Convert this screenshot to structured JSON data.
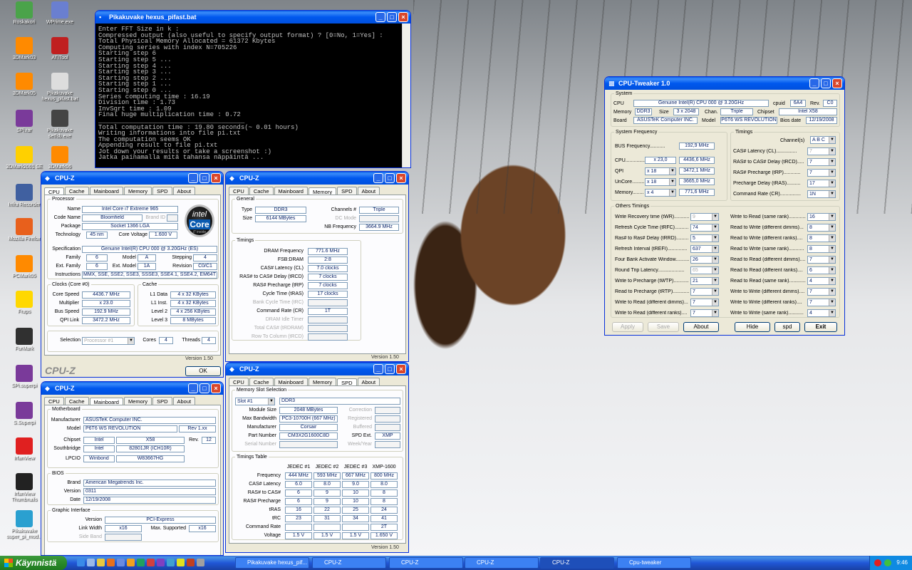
{
  "desktop_icons": [
    {
      "label": "Roskakori",
      "color": "#4aa34a"
    },
    {
      "label": "WPrime.exe",
      "color": "#6a7fd0"
    },
    {
      "label": "3DMark03",
      "color": "#ff8a00"
    },
    {
      "label": "ATITool",
      "color": "#c02020"
    },
    {
      "label": "3DMark05",
      "color": "#ff8a00"
    },
    {
      "label": "Pikakuvake hexus_pifast.bat",
      "color": "#dddddd"
    },
    {
      "label": "SPi.rar",
      "color": "#7a3a9a"
    },
    {
      "label": "Pikakuvake setfsb.exe",
      "color": "#444444"
    },
    {
      "label": "3DMark2001 SE",
      "color": "#ffd000"
    },
    {
      "label": "3DMark06",
      "color": "#ff8a00"
    },
    {
      "label": "Infra Recorder",
      "color": "#4060a0"
    },
    {
      "label": "Mozilla Firefox",
      "color": "#e8601c"
    },
    {
      "label": "PCMark05",
      "color": "#ff8a00"
    },
    {
      "label": "Fraps",
      "color": "#ffd800"
    },
    {
      "label": "FurMark",
      "color": "#303030"
    },
    {
      "label": "SPi.superpi",
      "color": "#7a3a9a"
    },
    {
      "label": "S.Superpi",
      "color": "#7a3a9a"
    },
    {
      "label": "IrfanView",
      "color": "#e02020"
    },
    {
      "label": "IrfanView Thumbnails",
      "color": "#222222"
    },
    {
      "label": "Pikakuvake super_pi_mod...",
      "color": "#2aa0d0"
    }
  ],
  "console": {
    "title": "Pikakuvake hexus_pifast.bat",
    "lines": [
      "",
      "Enter FFT Size in k :",
      "Compressed output (also useful to specify output format) ? [0=No, 1=Yes] :",
      "Total Physical Memory Allocated = 61372 Kbytes",
      "Computing series with index N=705226",
      "Starting step 6",
      "Starting step 5 ...",
      "Starting step 4 ...",
      "Starting step 3 ...",
      "Starting step 2 ...",
      "Starting step 1 ...",
      "Starting step 0 ...",
      "Series computing time : 16.19",
      "Division time : 1.73",
      "InvSqrt time : 1.09",
      "Final huge multiplication time : 0.72",
      "______________________________________",
      "Total computation time : 19.80 seconds(~ 0.01 hours)",
      "Writing informations into file pi.txt",
      "",
      "The computation seems OK",
      "Appending result to file pi.txt",
      "",
      "Jot down your results or take a screenshot :)",
      "Jatka painamalla mitä tahansa näppäintä ..."
    ]
  },
  "tabs": [
    "CPU",
    "Cache",
    "Mainboard",
    "Memory",
    "SPD",
    "About"
  ],
  "cpuz_title": "CPU-Z",
  "cpu": {
    "legend": "Processor",
    "name_l": "Name",
    "name": "Intel Core i7 Extreme 965",
    "code_l": "Code Name",
    "code": "Bloomfield",
    "brand_l": "Brand ID",
    "pkg_l": "Package",
    "pkg": "Socket 1366 LGA",
    "tech_l": "Technology",
    "tech": "45 nm",
    "cv_l": "Core Voltage",
    "cv": "1.600 V",
    "spec_l": "Specification",
    "spec": "Genuine Intel(R) CPU          000  @ 3.20GHz (ES)",
    "fam_l": "Family",
    "fam": "6",
    "model_l": "Model",
    "model": "A",
    "step_l": "Stepping",
    "step": "4",
    "efam_l": "Ext. Family",
    "efam": "6",
    "emod_l": "Ext. Model",
    "emod": "1A",
    "rev_l": "Revision",
    "rev": "C0/C1",
    "ins_l": "Instructions",
    "ins": "MMX, SSE, SSE2, SSE3, SSSE3, SSE4.1, SSE4.2, EM64T",
    "clk_legend": "Clocks (Core #0)",
    "cs_l": "Core Speed",
    "cs": "4436.7 MHz",
    "mul_l": "Multiplier",
    "mul": "x 23.0",
    "bs_l": "Bus Speed",
    "bs": "192.9 MHz",
    "qpi_l": "QPI Link",
    "qpi": "3472.2 MHz",
    "cache_legend": "Cache",
    "l1d_l": "L1 Data",
    "l1d": "4 x 32 KBytes",
    "l1i_l": "L1 Inst.",
    "l1i": "4 x 32 KBytes",
    "l2_l": "Level 2",
    "l2": "4 x 256 KBytes",
    "l3_l": "Level 3",
    "l3": "8 MBytes",
    "sel_l": "Selection",
    "sel": "Processor #1",
    "cores_l": "Cores",
    "cores": "4",
    "thr_l": "Threads",
    "thr": "4",
    "version": "Version 1.50",
    "brand": "CPU-Z",
    "ok": "OK",
    "logo1": "intel",
    "logo2": "Core",
    "logo3": "i7",
    "logo4": "inside"
  },
  "mem": {
    "gen_legend": "General",
    "type_l": "Type",
    "type": "DDR3",
    "ch_l": "Channels #",
    "ch": "Triple",
    "size_l": "Size",
    "size": "6144 MBytes",
    "dc_l": "DC Mode",
    "nb_l": "NB Frequency",
    "nb": "3664.9 MHz",
    "tim_legend": "Timings",
    "rows": [
      {
        "l": "DRAM Frequency",
        "v": "771.6 MHz",
        "d": false
      },
      {
        "l": "FSB:DRAM",
        "v": "2:8",
        "d": false
      },
      {
        "l": "CAS# Latency (CL)",
        "v": "7.0 clocks",
        "d": false
      },
      {
        "l": "RAS# to CAS# Delay (tRCD)",
        "v": "7 clocks",
        "d": false
      },
      {
        "l": "RAS# Precharge (tRP)",
        "v": "7 clocks",
        "d": false
      },
      {
        "l": "Cycle Time (tRAS)",
        "v": "17 clocks",
        "d": false
      },
      {
        "l": "Bank Cycle Time (tRC)",
        "v": "",
        "d": true
      },
      {
        "l": "Command Rate (CR)",
        "v": "1T",
        "d": false
      },
      {
        "l": "DRAM Idle Timer",
        "v": "",
        "d": true
      },
      {
        "l": "Total CAS# (tRDRAM)",
        "v": "",
        "d": true
      },
      {
        "l": "Row To Column (tRCD)",
        "v": "",
        "d": true
      }
    ],
    "version": "Version 1.50"
  },
  "mb": {
    "legend": "Motherboard",
    "man_l": "Manufacturer",
    "man": "ASUSTeK Computer INC.",
    "model_l": "Model",
    "model": "P6T6 WS REVOLUTION",
    "modelrev": "Rev 1.xx",
    "chip_l": "Chipset",
    "chip": "Intel",
    "chip2": "X58",
    "rev_l": "Rev.",
    "rev": "12",
    "sb_l": "Southbridge",
    "sb": "Intel",
    "sb2": "82801JR (ICH10R)",
    "lpc_l": "LPCIO",
    "lpc": "Winbond",
    "lpc2": "W83667HG",
    "bios_legend": "BIOS",
    "brand_l": "Brand",
    "brand": "American Megatrends Inc.",
    "ver_l": "Version",
    "ver": "0311",
    "date_l": "Date",
    "date": "12/19/2008",
    "gi_legend": "Graphic Interface",
    "gv_l": "Version",
    "gv": "PCI-Express",
    "lw_l": "Link Width",
    "lw": "x16",
    "ms_l": "Max. Supported",
    "ms": "x16",
    "sb_band_l": "Side Band"
  },
  "spd": {
    "legend": "Memory Slot Selection",
    "slot": "Slot #1",
    "slot_type": "DDR3",
    "ms_l": "Module Size",
    "ms": "2048 MBytes",
    "corr_l": "Correction",
    "mb_l": "Max Bandwidth",
    "mb": "PC3-10700H (667 MHz)",
    "reg_l": "Registered",
    "man_l": "Manufacturer",
    "man": "Corsair",
    "buf_l": "Buffered",
    "pn_l": "Part Number",
    "pn": "CM3X2G1600C8D",
    "ext_l": "SPD Ext.",
    "ext": "XMP",
    "sn_l": "Serial Number",
    "wy_l": "Week/Year",
    "tt_legend": "Timings Table",
    "cols": [
      "JEDEC #1",
      "JEDEC #2",
      "JEDEC #3",
      "XMP-1600"
    ],
    "rows": [
      {
        "l": "Frequency",
        "v": [
          "444 MHz",
          "593 MHz",
          "667 MHz",
          "800 MHz"
        ]
      },
      {
        "l": "CAS# Latency",
        "v": [
          "6.0",
          "8.0",
          "9.0",
          "8.0"
        ]
      },
      {
        "l": "RAS# to CAS#",
        "v": [
          "6",
          "9",
          "10",
          "8"
        ]
      },
      {
        "l": "RAS# Precharge",
        "v": [
          "6",
          "9",
          "10",
          "8"
        ]
      },
      {
        "l": "tRAS",
        "v": [
          "16",
          "22",
          "25",
          "24"
        ]
      },
      {
        "l": "tRC",
        "v": [
          "23",
          "31",
          "34",
          "41"
        ]
      },
      {
        "l": "Command Rate",
        "v": [
          "",
          "",
          "",
          "2T"
        ]
      },
      {
        "l": "Voltage",
        "v": [
          "1.5 V",
          "1.5 V",
          "1.5 V",
          "1.650 V"
        ]
      }
    ],
    "version": "Version 1.50"
  },
  "tw": {
    "title": "CPU-Tweaker 1.0",
    "sys_legend": "System",
    "cpu_l": "CPU",
    "cpu": "Genuine Intel(R) CPU          000  @ 3.20GHz",
    "cpuid_l": "cpuid",
    "cpuid": "6A4",
    "rev_l": "Rev.",
    "rev": "C0",
    "mem_l": "Memory",
    "mem": "DDR3",
    "size_l": "Size",
    "size": "3 x 2048",
    "chan_l": "Chan.",
    "chan": "Triple",
    "chipset_l": "Chipset",
    "chipset": "Intel X58",
    "board_l": "Board",
    "board": "ASUSTeK Computer INC.",
    "model_l": "Model",
    "model": "P6T6 WS REVOLUTION",
    "bdate_l": "Bios date",
    "bdate": "12/19/2008",
    "sf_legend": "System Frequency",
    "bus_l": "BUS Frequency...........",
    "bus": "192,9 MHz",
    "cpuf_l": "CPU...............",
    "cpum": "x 23,0",
    "cpuf": "4436,6 MHz",
    "qpi_l": "QPI",
    "qpim": "x 18",
    "qpif": "3472,1 MHz",
    "unc_l": "UnCore.........",
    "uncm": "x 18",
    "uncf": "3665,0 MHz",
    "memf_l": "Memory........",
    "memm": "x 4",
    "memf": "771,6 MHz",
    "tim_legend": "Timings",
    "chs_l": "Channel(s)",
    "chs": "A B C",
    "timings": [
      {
        "l": "CAS# Latency (CL)...............",
        "v": "7",
        "d": true
      },
      {
        "l": "RAS# to CAS# Delay (tRCD).......",
        "v": "7",
        "d": false
      },
      {
        "l": "RAS# Precharge (tRP)............",
        "v": "7",
        "d": false
      },
      {
        "l": "Precharge Delay (tRAS)..........",
        "v": "17",
        "d": false
      },
      {
        "l": "Command Rate (CR)...............",
        "v": "1N",
        "d": false
      }
    ],
    "ot_legend": "Others Timings",
    "left": [
      {
        "l": "Write Recovery time (tWR)............",
        "v": "9",
        "d": true
      },
      {
        "l": "Refresh Cycle Time (tRFC)............",
        "v": "74",
        "d": false
      },
      {
        "l": "Ras# to Ras# Delay (tRRD)............",
        "v": "5",
        "d": false
      },
      {
        "l": "Refresh Interval (tREFI)..............",
        "v": "637",
        "d": false
      },
      {
        "l": "Four Bank Activate Window............",
        "v": "26",
        "d": false
      },
      {
        "l": "Round Trip Latency...................",
        "v": "65",
        "d": true
      },
      {
        "l": "Write to Precharge (tWTP)............",
        "v": "21",
        "d": false
      },
      {
        "l": "Read to Precharge (tRTP)..............",
        "v": "7",
        "d": false
      },
      {
        "l": "Write to Read (different dimms)...",
        "v": "7",
        "d": false
      },
      {
        "l": "Write to Read (different ranks)....",
        "v": "7",
        "d": false
      }
    ],
    "right": [
      {
        "l": "Write to Read (same rank).............",
        "v": "16"
      },
      {
        "l": "Read to Write (different dimms)...",
        "v": "8"
      },
      {
        "l": "Read to Write (different ranks)....",
        "v": "8"
      },
      {
        "l": "Read to Write (same rank)...........",
        "v": "8"
      },
      {
        "l": "Read to Read (different dimms)....",
        "v": "7"
      },
      {
        "l": "Read to Read (different ranks)....",
        "v": "6"
      },
      {
        "l": "Read to Read (same rank)..............",
        "v": "4"
      },
      {
        "l": "Write to Write (different dimms)....",
        "v": "7"
      },
      {
        "l": "Write to Write (different ranks)....",
        "v": "7"
      },
      {
        "l": "Write to Write (same rank)...........",
        "v": "4"
      }
    ],
    "apply": "Apply",
    "save": "Save",
    "about": "About",
    "hide": "Hide",
    "spd": "spd",
    "exit": "Exit"
  },
  "taskbar": {
    "start": "Käynnistä",
    "items": [
      {
        "label": "Pikakuvake hexus_pif...",
        "act": false
      },
      {
        "label": "CPU-Z",
        "act": false
      },
      {
        "label": "CPU-Z",
        "act": false
      },
      {
        "label": "CPU-Z",
        "act": false
      },
      {
        "label": "CPU-Z",
        "act": true
      },
      {
        "label": "Cpu-tweaker",
        "act": false
      }
    ],
    "time": "9:46"
  }
}
